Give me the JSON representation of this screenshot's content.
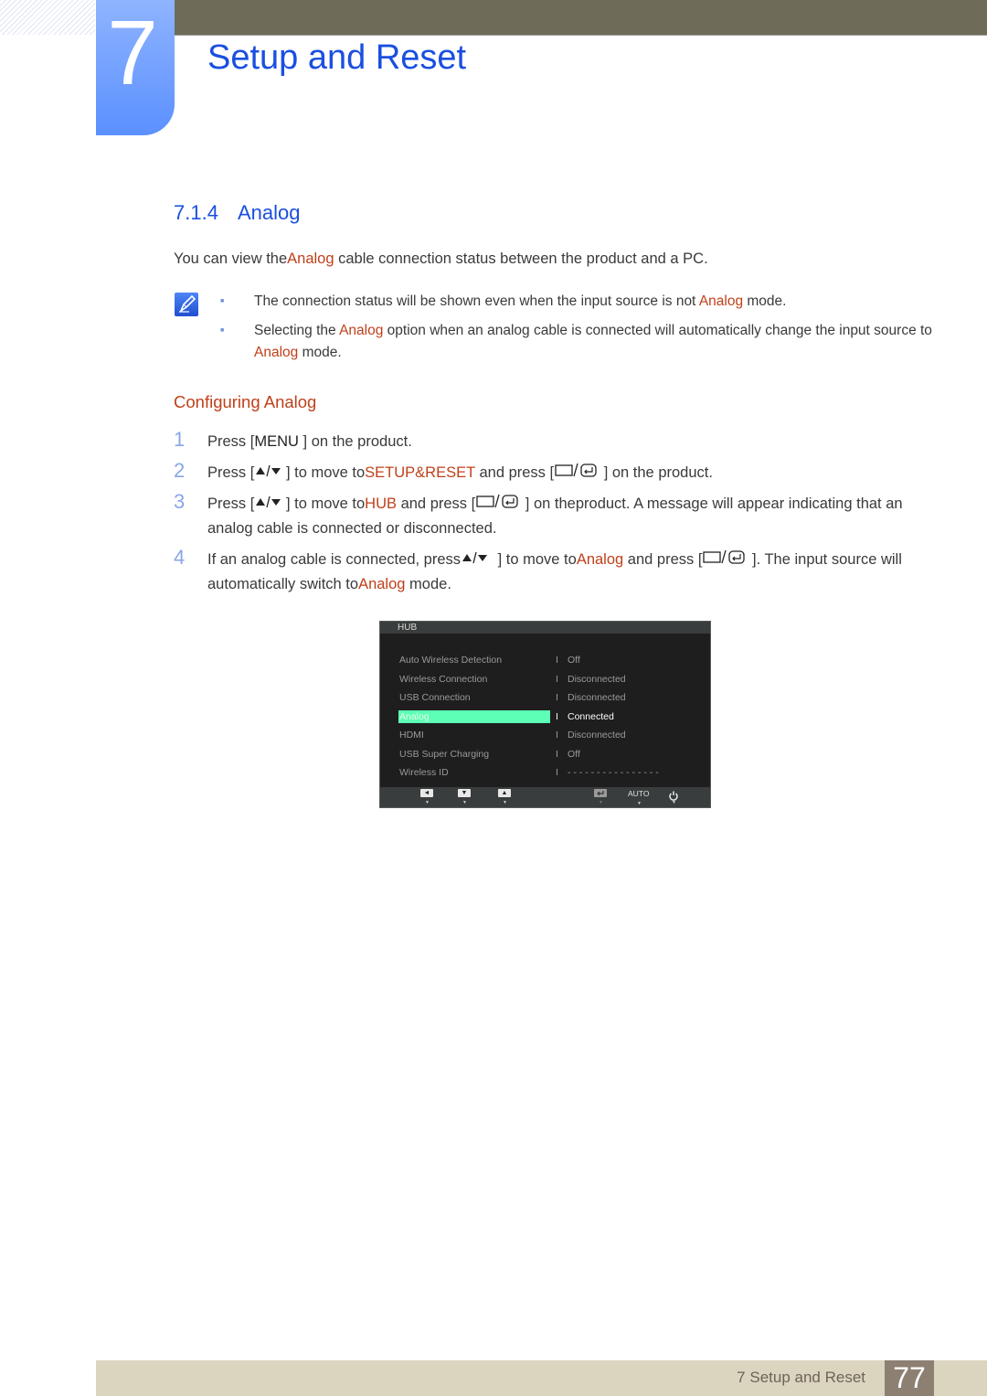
{
  "chapter": {
    "number": "7",
    "title": "Setup and Reset"
  },
  "section": {
    "number": "7.1.4",
    "title": "Analog"
  },
  "intro": {
    "before": "You can view the",
    "highlight": "Analog",
    "after": " cable connection status between the product and a PC."
  },
  "notes": [
    {
      "before": "The connection status will be shown even when the input source is not ",
      "highlight": "Analog",
      "after": " mode."
    },
    {
      "before": "Selecting the ",
      "highlight": "Analog",
      "after": " option when an analog cable is connected will automatically change the input source to ",
      "highlight2": "Analog",
      "after2": " mode."
    }
  ],
  "subheading": "Configuring Analog",
  "steps": [
    {
      "num": "1",
      "p1": "Press [",
      "key": "MENU",
      "p2": " ] on the product."
    },
    {
      "num": "2",
      "p1": "Press [",
      "p2": " ] to move to",
      "highlight": "SETUP&RESET",
      "p3": " and press [",
      "p4": " ] on the product."
    },
    {
      "num": "3",
      "p1": "Press [",
      "p2": " ] to move to",
      "highlight": "HUB",
      "p3": " and press [",
      "p4": " ] on theproduct. A message will appear indicating that an analog cable is connected or disconnected."
    },
    {
      "num": "4",
      "p1": "If an analog cable is connected, press",
      "p2": " ] to move to",
      "highlight": "Analog",
      "p3": " and press [",
      "p4": " ]. The input source will automatically switch to",
      "highlight2": "Analog",
      "p5": " mode."
    }
  ],
  "osd": {
    "title": "HUB",
    "rows": [
      {
        "label": "Auto Wireless Detection",
        "sep": "I",
        "value": "Off"
      },
      {
        "label": "Wireless Connection",
        "sep": "I",
        "value": "Disconnected"
      },
      {
        "label": "USB Connection",
        "sep": "I",
        "value": "Disconnected"
      },
      {
        "label": "Analog",
        "sep": "I",
        "value": "Connected",
        "selected": true
      },
      {
        "label": "HDMI",
        "sep": "I",
        "value": "Disconnected"
      },
      {
        "label": "USB Super Charging",
        "sep": "I",
        "value": "Off"
      },
      {
        "label": "Wireless ID",
        "sep": "I",
        "value": "- - - - - - - - - - - - - - - -"
      }
    ],
    "footer": {
      "left_label": "◄",
      "down_label": "▼",
      "up_label": "▲",
      "auto_label": "AUTO",
      "tick": "▼"
    },
    "colors": {
      "selected": "#5cffb5",
      "background": "#1e1e1e"
    }
  },
  "footer": {
    "title": "7 Setup and Reset",
    "page": "77"
  },
  "colors": {
    "accent_blue": "#1a4fe0",
    "highlight_red": "#c0401a",
    "chapter_tab": "#5b90ff",
    "top_bar": "#6e6c58",
    "footer_band": "#dbd5c0",
    "page_box": "#8d8073"
  }
}
